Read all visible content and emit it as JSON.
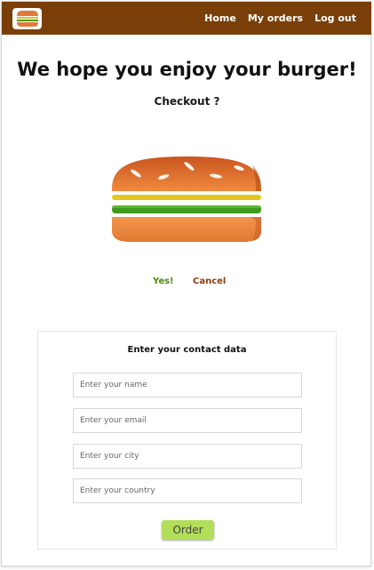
{
  "nav": {
    "home": "Home",
    "orders": "My orders",
    "logout": "Log out"
  },
  "page": {
    "title": "We hope you enjoy your burger!",
    "subtitle": "Checkout ?"
  },
  "actions": {
    "yes": "Yes!",
    "cancel": "Cancel"
  },
  "form": {
    "title": "Enter your contact data",
    "name_placeholder": "Enter your name",
    "email_placeholder": "Enter your email",
    "city_placeholder": "Enter your city",
    "country_placeholder": "Enter your country",
    "submit": "Order"
  },
  "colors": {
    "topbar": "#7a3f08",
    "yes": "#4a8a0a",
    "cancel": "#8a3d10",
    "order_button": "#b3de5a",
    "bun": "#e07a3a"
  },
  "icons": {
    "logo": "burger-logo-icon",
    "illustration": "burger-illustration"
  }
}
